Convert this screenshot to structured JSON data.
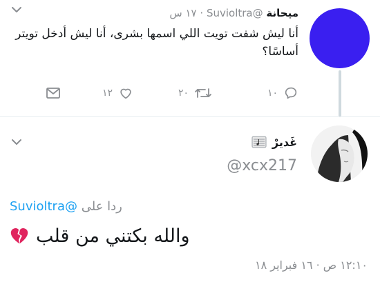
{
  "parent_tweet": {
    "display_name": "ميحانة",
    "handle": "@Suvioltra",
    "separator": "·",
    "time": "١٧ س",
    "text": "أنا ليش شفت تويت اللي اسمها بشرى، أنا ليش أدخل تويتر أساسًا؟",
    "actions": {
      "reply_count": "١٠",
      "retweet_count": "٢٠",
      "like_count": "١٢"
    }
  },
  "focused_tweet": {
    "display_name": "غَديرْ",
    "handle": "@xcx217",
    "reply_prefix": "ردا على",
    "reply_to_handle": "@Suvioltra",
    "text": "والله بكتني من قلب",
    "emoji": "broken-heart-icon",
    "timestamp": "١٢:١٠ ص · ١٦ فبراير ١٨"
  },
  "colors": {
    "accent": "#1da1f2",
    "muted": "#8a8d91",
    "text": "#14171a",
    "avatar_parent": "#3a1ff0",
    "thread_line": "#cfd9de",
    "broken_heart": "#e0245e"
  }
}
